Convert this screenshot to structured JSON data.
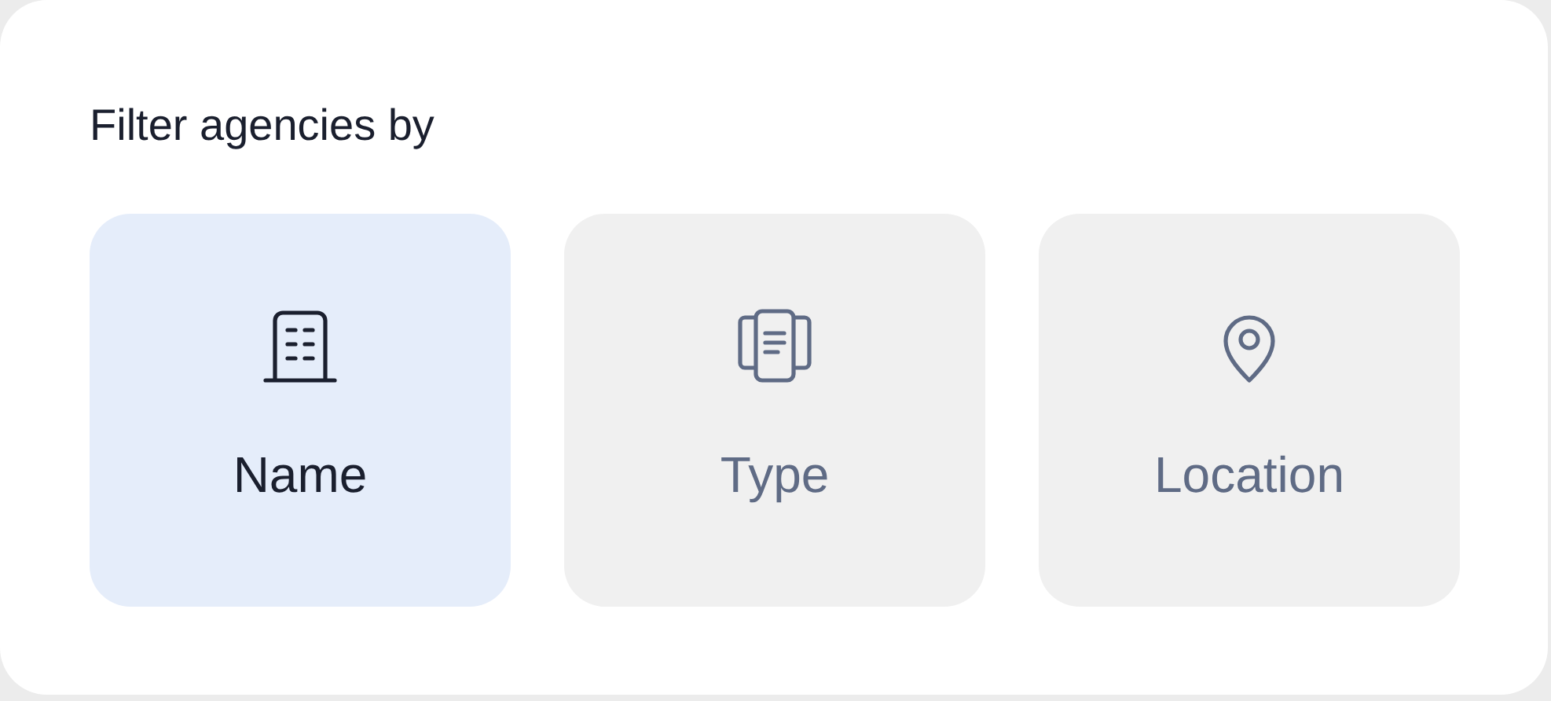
{
  "title": "Filter agencies by",
  "options": [
    {
      "kind": "building",
      "label": "Name",
      "selected": true
    },
    {
      "kind": "cards",
      "label": "Type",
      "selected": false
    },
    {
      "kind": "pin",
      "label": "Location",
      "selected": false
    }
  ]
}
